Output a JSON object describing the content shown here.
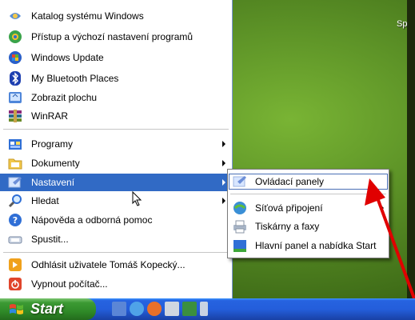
{
  "desktop": {
    "corner_text": "Sp"
  },
  "menu": {
    "items": [
      {
        "label": "Katalog systému Windows",
        "icon": "catalog-icon"
      },
      {
        "label": "Přístup a výchozí nastavení programů",
        "icon": "program-access-icon"
      },
      {
        "label": "Windows Update",
        "icon": "windows-update-icon"
      },
      {
        "label": "My Bluetooth Places",
        "icon": "bluetooth-icon"
      },
      {
        "label": "Zobrazit plochu",
        "icon": "show-desktop-icon"
      },
      {
        "label": "WinRAR",
        "icon": "winrar-icon"
      },
      {
        "label": "Programy",
        "icon": "programs-icon"
      },
      {
        "label": "Dokumenty",
        "icon": "documents-icon"
      },
      {
        "label": "Nastavení",
        "icon": "settings-icon"
      },
      {
        "label": "Hledat",
        "icon": "search-icon"
      },
      {
        "label": "Nápověda a odborná pomoc",
        "icon": "help-icon"
      },
      {
        "label": "Spustit...",
        "icon": "run-icon"
      },
      {
        "label": "Odhlásit uživatele Tomáš Kopecký...",
        "icon": "logoff-icon"
      },
      {
        "label": "Vypnout počítač...",
        "icon": "shutdown-icon"
      }
    ]
  },
  "submenu": {
    "items": [
      {
        "label": "Ovládací panely",
        "icon": "control-panel-icon"
      },
      {
        "label": "Síťová připojení",
        "icon": "network-connections-icon"
      },
      {
        "label": "Tiskárny a faxy",
        "icon": "printers-icon"
      },
      {
        "label": "Hlavní panel a nabídka Start",
        "icon": "taskbar-start-icon"
      }
    ]
  },
  "taskbar": {
    "start_label": "Start"
  },
  "colors": {
    "highlight": "#316ac5",
    "taskbar": "#245edb",
    "start_green": "#3c9a33",
    "annotation_arrow": "#e00000"
  }
}
